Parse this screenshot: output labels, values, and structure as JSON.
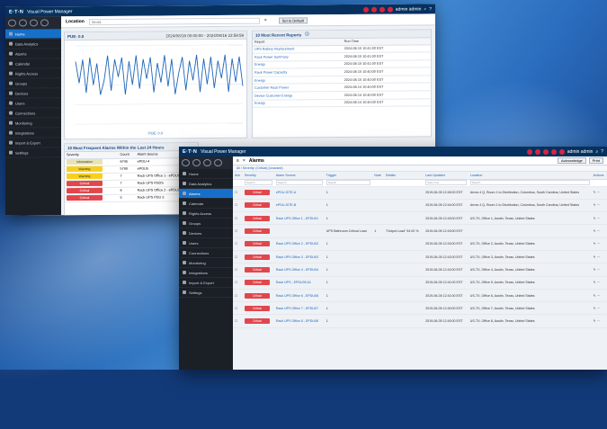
{
  "colors": {
    "brand": "#06315f",
    "accent": "#1670c9",
    "critical": "#e0474c",
    "warning": "#f7cf1f",
    "info": "#e8e3b6"
  },
  "back_window": {
    "app_title": "Visual Power Manager",
    "user": "admin admin",
    "location_label": "Location",
    "location_value": "World",
    "set_default_label": "Set to Default",
    "sidebar": [
      {
        "label": "Home",
        "icon": "home-icon",
        "active": true
      },
      {
        "label": "Data Analytics",
        "icon": "chart-icon"
      },
      {
        "label": "Alarms",
        "icon": "bell-icon"
      },
      {
        "label": "Calendar",
        "icon": "calendar-icon"
      },
      {
        "label": "Rights Access",
        "icon": "key-icon"
      },
      {
        "label": "Groups",
        "icon": "group-icon"
      },
      {
        "label": "Devices",
        "icon": "device-icon"
      },
      {
        "label": "Users",
        "icon": "user-icon"
      },
      {
        "label": "Connections",
        "icon": "link-icon"
      },
      {
        "label": "Monitoring",
        "icon": "monitor-icon"
      },
      {
        "label": "Integrations",
        "icon": "puzzle-icon"
      },
      {
        "label": "Import & Export",
        "icon": "swap-icon"
      },
      {
        "label": "Settings",
        "icon": "gear-icon"
      }
    ],
    "chart_panel": {
      "title": "PUE: 0.0",
      "range": "2024/08/16 00:00:00 - 2024/08/16 23:59:59",
      "legend": "PUE: 0.0"
    },
    "reports_panel": {
      "title": "10 Most Recent Reports",
      "columns": [
        "Report",
        "Run Time"
      ],
      "rows": [
        [
          "UPS Battery Replacement",
          "2024-08-15 10:41:00 EST"
        ],
        [
          "Rack Power Summary",
          "2024-08-15 10:41:00 EST"
        ],
        [
          "Energy",
          "2024-08-15 10:41:00 EST"
        ],
        [
          "Rack Power Capacity",
          "2024-08-15 10:40:00 EST"
        ],
        [
          "Energy",
          "2024-08-15 10:40:00 EST"
        ],
        [
          "Customer Rack Power",
          "2024-08-14 10:40:00 EST"
        ],
        [
          "Device Customer Energy",
          "2024-08-14 10:40:00 EST"
        ],
        [
          "Energy",
          "2024-08-14 10:40:00 EST"
        ]
      ]
    },
    "alarm_panel": {
      "title": "10 Most Frequent Alarms Within the Last 24 Hours",
      "columns": [
        "Severity",
        "Count",
        "Alarm Source"
      ],
      "rows": [
        {
          "sev": "Information",
          "cls": "s-info",
          "count": "6745",
          "source": "ePDU-4"
        },
        {
          "sev": "Warning",
          "cls": "s-warn",
          "count": "5790",
          "source": "ePDU5"
        },
        {
          "sev": "Warning",
          "cls": "s-warn",
          "count": "7",
          "source": "Rack UPS Office 1 - ePDU1"
        },
        {
          "sev": "Critical",
          "cls": "s-crit",
          "count": "7",
          "source": "Rack UPS RSDS"
        },
        {
          "sev": "Critical",
          "cls": "s-crit",
          "count": "6",
          "source": "Rack UPS Office 2 - ePDU2"
        },
        {
          "sev": "Critical",
          "cls": "s-crit",
          "count": "5",
          "source": "Rack UPS PDU 3"
        }
      ]
    }
  },
  "front_window": {
    "app_title": "Visual Power Manager",
    "user": "admin admin",
    "page_title": "Alarms",
    "breadcrumb": "All / Severity: (Critical) (Unacked)",
    "toolbar": {
      "ack_label": "Acknowledge",
      "print_label": "Print"
    },
    "sidebar": [
      {
        "label": "Home",
        "icon": "home-icon"
      },
      {
        "label": "Data Analytics",
        "icon": "chart-icon"
      },
      {
        "label": "Alarms",
        "icon": "bell-icon",
        "active": true
      },
      {
        "label": "Calendar",
        "icon": "calendar-icon"
      },
      {
        "label": "Rights Access",
        "icon": "key-icon"
      },
      {
        "label": "Groups",
        "icon": "group-icon"
      },
      {
        "label": "Devices",
        "icon": "device-icon"
      },
      {
        "label": "Users",
        "icon": "user-icon"
      },
      {
        "label": "Connections",
        "icon": "link-icon"
      },
      {
        "label": "Monitoring",
        "icon": "monitor-icon"
      },
      {
        "label": "Integrations",
        "icon": "puzzle-icon"
      },
      {
        "label": "Import & Export",
        "icon": "swap-icon"
      },
      {
        "label": "Settings",
        "icon": "gear-icon"
      }
    ],
    "columns": [
      "Ack",
      "Severity",
      "Alarm Source",
      "Trigger",
      "Note",
      "Details",
      "Last Updated",
      "Location",
      "Actions"
    ],
    "filters": [
      "",
      "Search",
      "Search",
      "Search",
      "",
      "",
      "Date time",
      "Search",
      ""
    ],
    "rows": [
      {
        "sev": "Critical",
        "source": "ePDU-SITE-A",
        "trigger": "1",
        "note": "",
        "details": "",
        "updated": "2019-06-05 12:45:00 EST",
        "location": "Arrow 4 Q, Room 1 to Distribution, Columbus, South Carolina, United States"
      },
      {
        "sev": "Critical",
        "source": "ePDU-SITE-B",
        "trigger": "1",
        "note": "",
        "details": "",
        "updated": "2019-06-05 12:44:00 EST",
        "location": "Arrow 4 Q, Room 1 to Distribution, Columbus, South Carolina, United States"
      },
      {
        "sev": "Critical",
        "source": "Rack UPS Office 1 - EPDU01",
        "trigger": "1",
        "note": "",
        "details": "",
        "updated": "2019-06-05 12:43:00 EST",
        "location": "US-TX, Office 1, Austin, Texas, United States"
      },
      {
        "sev": "Critical",
        "source": "",
        "trigger": "UPS Bathroom Critical Load",
        "note": "1",
        "details": "\"Output Load\" 94.00 %",
        "updated": "2019-06-05 12:43:00 EST",
        "location": ""
      },
      {
        "sev": "Critical",
        "source": "Rack UPS Office 2 - EPDU02",
        "trigger": "1",
        "note": "",
        "details": "",
        "updated": "2019-06-05 12:43:00 EST",
        "location": "US-TX, Office 2, Austin, Texas, United States"
      },
      {
        "sev": "Critical",
        "source": "Rack UPS Office 3 - EPDU03",
        "trigger": "1",
        "note": "",
        "details": "",
        "updated": "2019-06-05 12:42:00 EST",
        "location": "US-TX, Office 3, Austin, Texas, United States"
      },
      {
        "sev": "Critical",
        "source": "Rack UPS Office 4 - EPDU04",
        "trigger": "1",
        "note": "",
        "details": "",
        "updated": "2019-06-05 12:42:00 EST",
        "location": "US-TX, Office 4, Austin, Texas, United States"
      },
      {
        "sev": "Critical",
        "source": "Rack UPS - EPDU05 A1",
        "trigger": "1",
        "note": "",
        "details": "",
        "updated": "2019-06-05 12:41:00 EST",
        "location": "US-TX, Office 5, Austin, Texas, United States"
      },
      {
        "sev": "Critical",
        "source": "Rack UPS Office 6 - EPDU06",
        "trigger": "1",
        "note": "",
        "details": "",
        "updated": "2019-06-05 12:41:00 EST",
        "location": "US-TX, Office 6, Austin, Texas, United States"
      },
      {
        "sev": "Critical",
        "source": "Rack UPS Office 7 - EPDU07",
        "trigger": "1",
        "note": "",
        "details": "",
        "updated": "2019-06-05 12:40:00 EST",
        "location": "US-TX, Office 7, Austin, Texas, United States"
      },
      {
        "sev": "Critical",
        "source": "Rack UPS Office 8 - EPDU08",
        "trigger": "1",
        "note": "",
        "details": "",
        "updated": "2019-06-05 12:40:00 EST",
        "location": "US-TX, Office 8, Austin, Texas, United States"
      }
    ],
    "pagination": "1 2 3 > 10 20 50"
  },
  "chart_data": {
    "type": "line",
    "title": "PUE: 0.0",
    "xlabel": "",
    "ylabel": "",
    "series": [
      {
        "name": "PUE: 0.0",
        "values": [
          3.2,
          2.1,
          3.3,
          1.6,
          3.4,
          2.0,
          3.1,
          1.5,
          2.2,
          3.5,
          1.7,
          3.3,
          2.4,
          3.4,
          1.5,
          3.2,
          2.0,
          3.5,
          1.8,
          3.3,
          2.3,
          3.4,
          1.6,
          3.1,
          2.1,
          3.5,
          1.9,
          3.3,
          1.5,
          2.6,
          3.4,
          1.7,
          3.2,
          2.2,
          3.5,
          1.6,
          3.3,
          2.0,
          3.4,
          1.8,
          3.2,
          2.3,
          3.5,
          1.6,
          3.3,
          2.1,
          3.4,
          1.9
        ]
      }
    ],
    "ylim": [
      0,
      4
    ],
    "grid": true
  }
}
